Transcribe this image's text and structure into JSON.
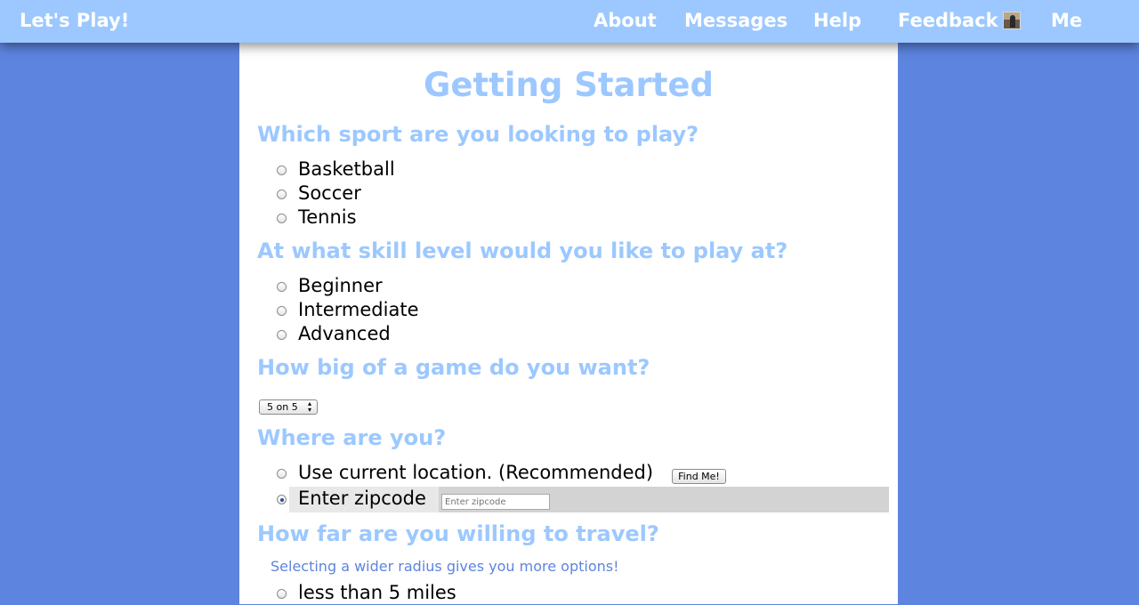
{
  "header": {
    "brand": "Let's Play!",
    "nav": {
      "about": "About",
      "messages": "Messages",
      "help": "Help",
      "feedback": "Feedback",
      "me": "Me"
    }
  },
  "main": {
    "title": "Getting Started",
    "sport": {
      "question": "Which sport are you looking to play?",
      "options": [
        "Basketball",
        "Soccer",
        "Tennis"
      ]
    },
    "skill": {
      "question": "At what skill level would you like to play at?",
      "options": [
        "Beginner",
        "Intermediate",
        "Advanced"
      ]
    },
    "game_size": {
      "question": "How big of a game do you want?",
      "selected": "5 on 5"
    },
    "location": {
      "question": "Where are you?",
      "current_label": "Use current location. (Recommended)",
      "find_button": "Find Me!",
      "zip_label": "Enter zipcode",
      "zip_placeholder": "Enter zipcode",
      "zip_value": "",
      "selected": "zipcode"
    },
    "travel": {
      "question": "How far are you willing to travel?",
      "hint": "Selecting a wider radius gives you more options!",
      "options": [
        "less than 5 miles"
      ]
    }
  },
  "colors": {
    "page_bg": "#5d84de",
    "header_bg": "#9cc8ff",
    "heading": "#9cc8ff",
    "hint": "#5d84de"
  },
  "icons": {
    "avatar": "profile-photo",
    "select_arrows": "up-down-arrows-icon"
  }
}
